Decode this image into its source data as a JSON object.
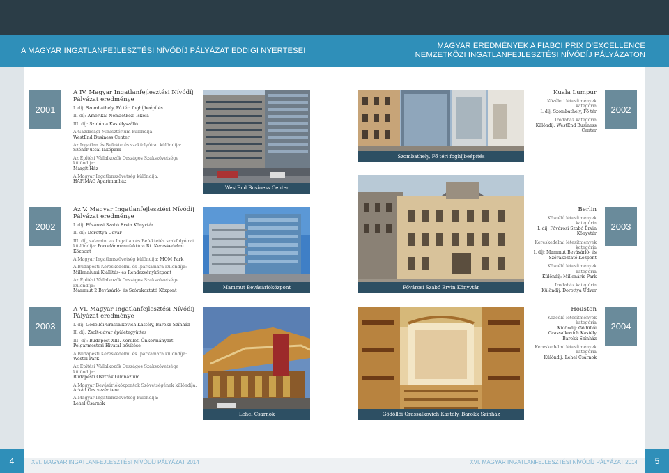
{
  "header": {
    "left": "A MAGYAR INGATLANFEJLESZTÉSI NÍVÓDÍJ PÁLYÁZAT EDDIGI NYERTESEI",
    "right_line1": "MAGYAR EREDMÉNYEK A FIABCI PRIX D'EXCELLENCE",
    "right_line2": "NEMZETKÖZI INGATLANFEJLESZTÉSI NÍVÓDÍJ PÁLYÁZATON"
  },
  "footer": {
    "left_page": "4",
    "right_page": "5",
    "left_text": "XVI. MAGYAR INGATLANFEJLESZTÉSI NÍVÓDÍJ PÁLYÁZAT 2014",
    "right_text": "XVI. MAGYAR INGATLANFEJLESZTÉSI NÍVÓDÍJ PÁLYÁZAT 2014"
  },
  "left_years": [
    "2001",
    "2002",
    "2003"
  ],
  "right_years": [
    "2002",
    "2003",
    "2004"
  ],
  "sections": [
    {
      "title": "A IV. Magyar Ingatlanfejlesztési Nívódíj Pályázat eredménye",
      "items": [
        {
          "label": "I. díj:",
          "value": "Szombathely, Fő téri foghíjbeépítés"
        },
        {
          "label": "II. díj:",
          "value": "Amerikai Nemzetközi Iskola"
        },
        {
          "label": "III. díj:",
          "value": "Szidónia Kastélyszálló"
        },
        {
          "label": "A Gazdasági Minisztérium különdíja:",
          "value": "WestEnd Business Center"
        },
        {
          "label": "Az Ingatlan és Befektetés szakfolyóirat különdíja:",
          "value": "Széher utcai lakópark"
        },
        {
          "label": "Az Építési Vállalkozók Országos Szakszövetsége különdíja:",
          "value": "Margit Ház"
        },
        {
          "label": "A Magyar Ingatlanszövetség különdíja:",
          "value": "HAPIMAG Apartmanház"
        }
      ]
    },
    {
      "title": "Az V. Magyar Ingatlanfejlesztési Nívódíj Pályázat eredménye",
      "items": [
        {
          "label": "I. díj:",
          "value": "Fővárosi Szabó Ervin Könyvtár"
        },
        {
          "label": "II. díj:",
          "value": "Dorottya Udvar"
        },
        {
          "label": "III. díj, valamint az Ingatlan és Befektetés szakfolyóirat kü-lön­díja:",
          "value": "Porcelánmanufaktúra Rt. Kereskedelmi Központ"
        },
        {
          "label": "A Magyar Ingatlanszövetség különdíja:",
          "value": "MOM Park"
        },
        {
          "label": "A Budapesti Kereskedelmi és Iparkamara különdíja:",
          "value": "Millenniumi Kiállítás- és Rendezvényközpont"
        },
        {
          "label": "Az Építési Vállalkozók Országos Szakszövetsége különdíja:",
          "value": "Mammut 2 Bevásárló- és Szórakoztató Központ"
        }
      ]
    },
    {
      "title": "A VI. Magyar Ingatlanfejlesztési Nívódíj Pályázat eredménye",
      "items": [
        {
          "label": "I. díj:",
          "value": "Gödöllői Grassalkovich Kastély, Barokk Színház"
        },
        {
          "label": "II. díj:",
          "value": "Zsolt-udvar épületegyüttes"
        },
        {
          "label": "III. díj:",
          "value": "Budapest XIII. Kerületi Önkormányzat Polgármesteri Hivatal bővítése"
        },
        {
          "label": "A Budapesti Kereskedelmi és Iparkamara különdíja:",
          "value": "Westel Park"
        },
        {
          "label": "Az Építési Vállalkozók Országos Szakszövetsége különdíja:",
          "value": "Budapesti Osztrák Gimnázium"
        },
        {
          "label": "A Magyar Bevásárlóközpontok Szövetségének különdíja:",
          "value": "Árkád Örs vezér tere"
        },
        {
          "label": "A Magyar Ingatlanszövetség különdíja:",
          "value": "Lehel Csarnok"
        }
      ]
    }
  ],
  "photos": {
    "westend": "WestEnd Business Center",
    "szombathely": "Szombathely, Fő téri foghíjbeépítés",
    "mammut": "Mammut Bevásárlóközpont",
    "szabo": "Fővárosi Szabó Ervin Könyvtár",
    "lehel": "Lehel Csarnok",
    "godollo": "Gödöllői Grassalkovich Kastély, Barokk Színház"
  },
  "right_blocks": [
    {
      "city": "Kuala Lumpur",
      "items": [
        {
          "label": "Közéleti létesítmények kategória",
          "value": "I. díj: Szombathely, Fő tér"
        },
        {
          "label": "Irodaház kategória",
          "value": "Különdíj: WestEnd Business Center"
        }
      ]
    },
    {
      "city": "Berlin",
      "items": [
        {
          "label": "Közcélú létesítmények kategória",
          "value": "I. díj: Fővárosi Szabó Ervin Könyvtár"
        },
        {
          "label": "Kereskedelmi létesítmények kategória",
          "value": "I. díj: Mammut Bevásárló- és Szórakoztató Központ"
        },
        {
          "label": "Közcélú létesítmények kategória",
          "value": "Különdíj: Millenáris Park"
        },
        {
          "label": "Irodaház kategória",
          "value": "Különdíj: Dorottya Udvar"
        }
      ]
    },
    {
      "city": "Houston",
      "items": [
        {
          "label": "Közcélú létesítmények kategória",
          "value": "Különdíj: Gödöllői Grassalkovich Kastély Barokk Színház"
        },
        {
          "label": "Kereskedelmi létesítmények kategória",
          "value": "Különdíj: Lehel Csarnok"
        }
      ]
    }
  ]
}
